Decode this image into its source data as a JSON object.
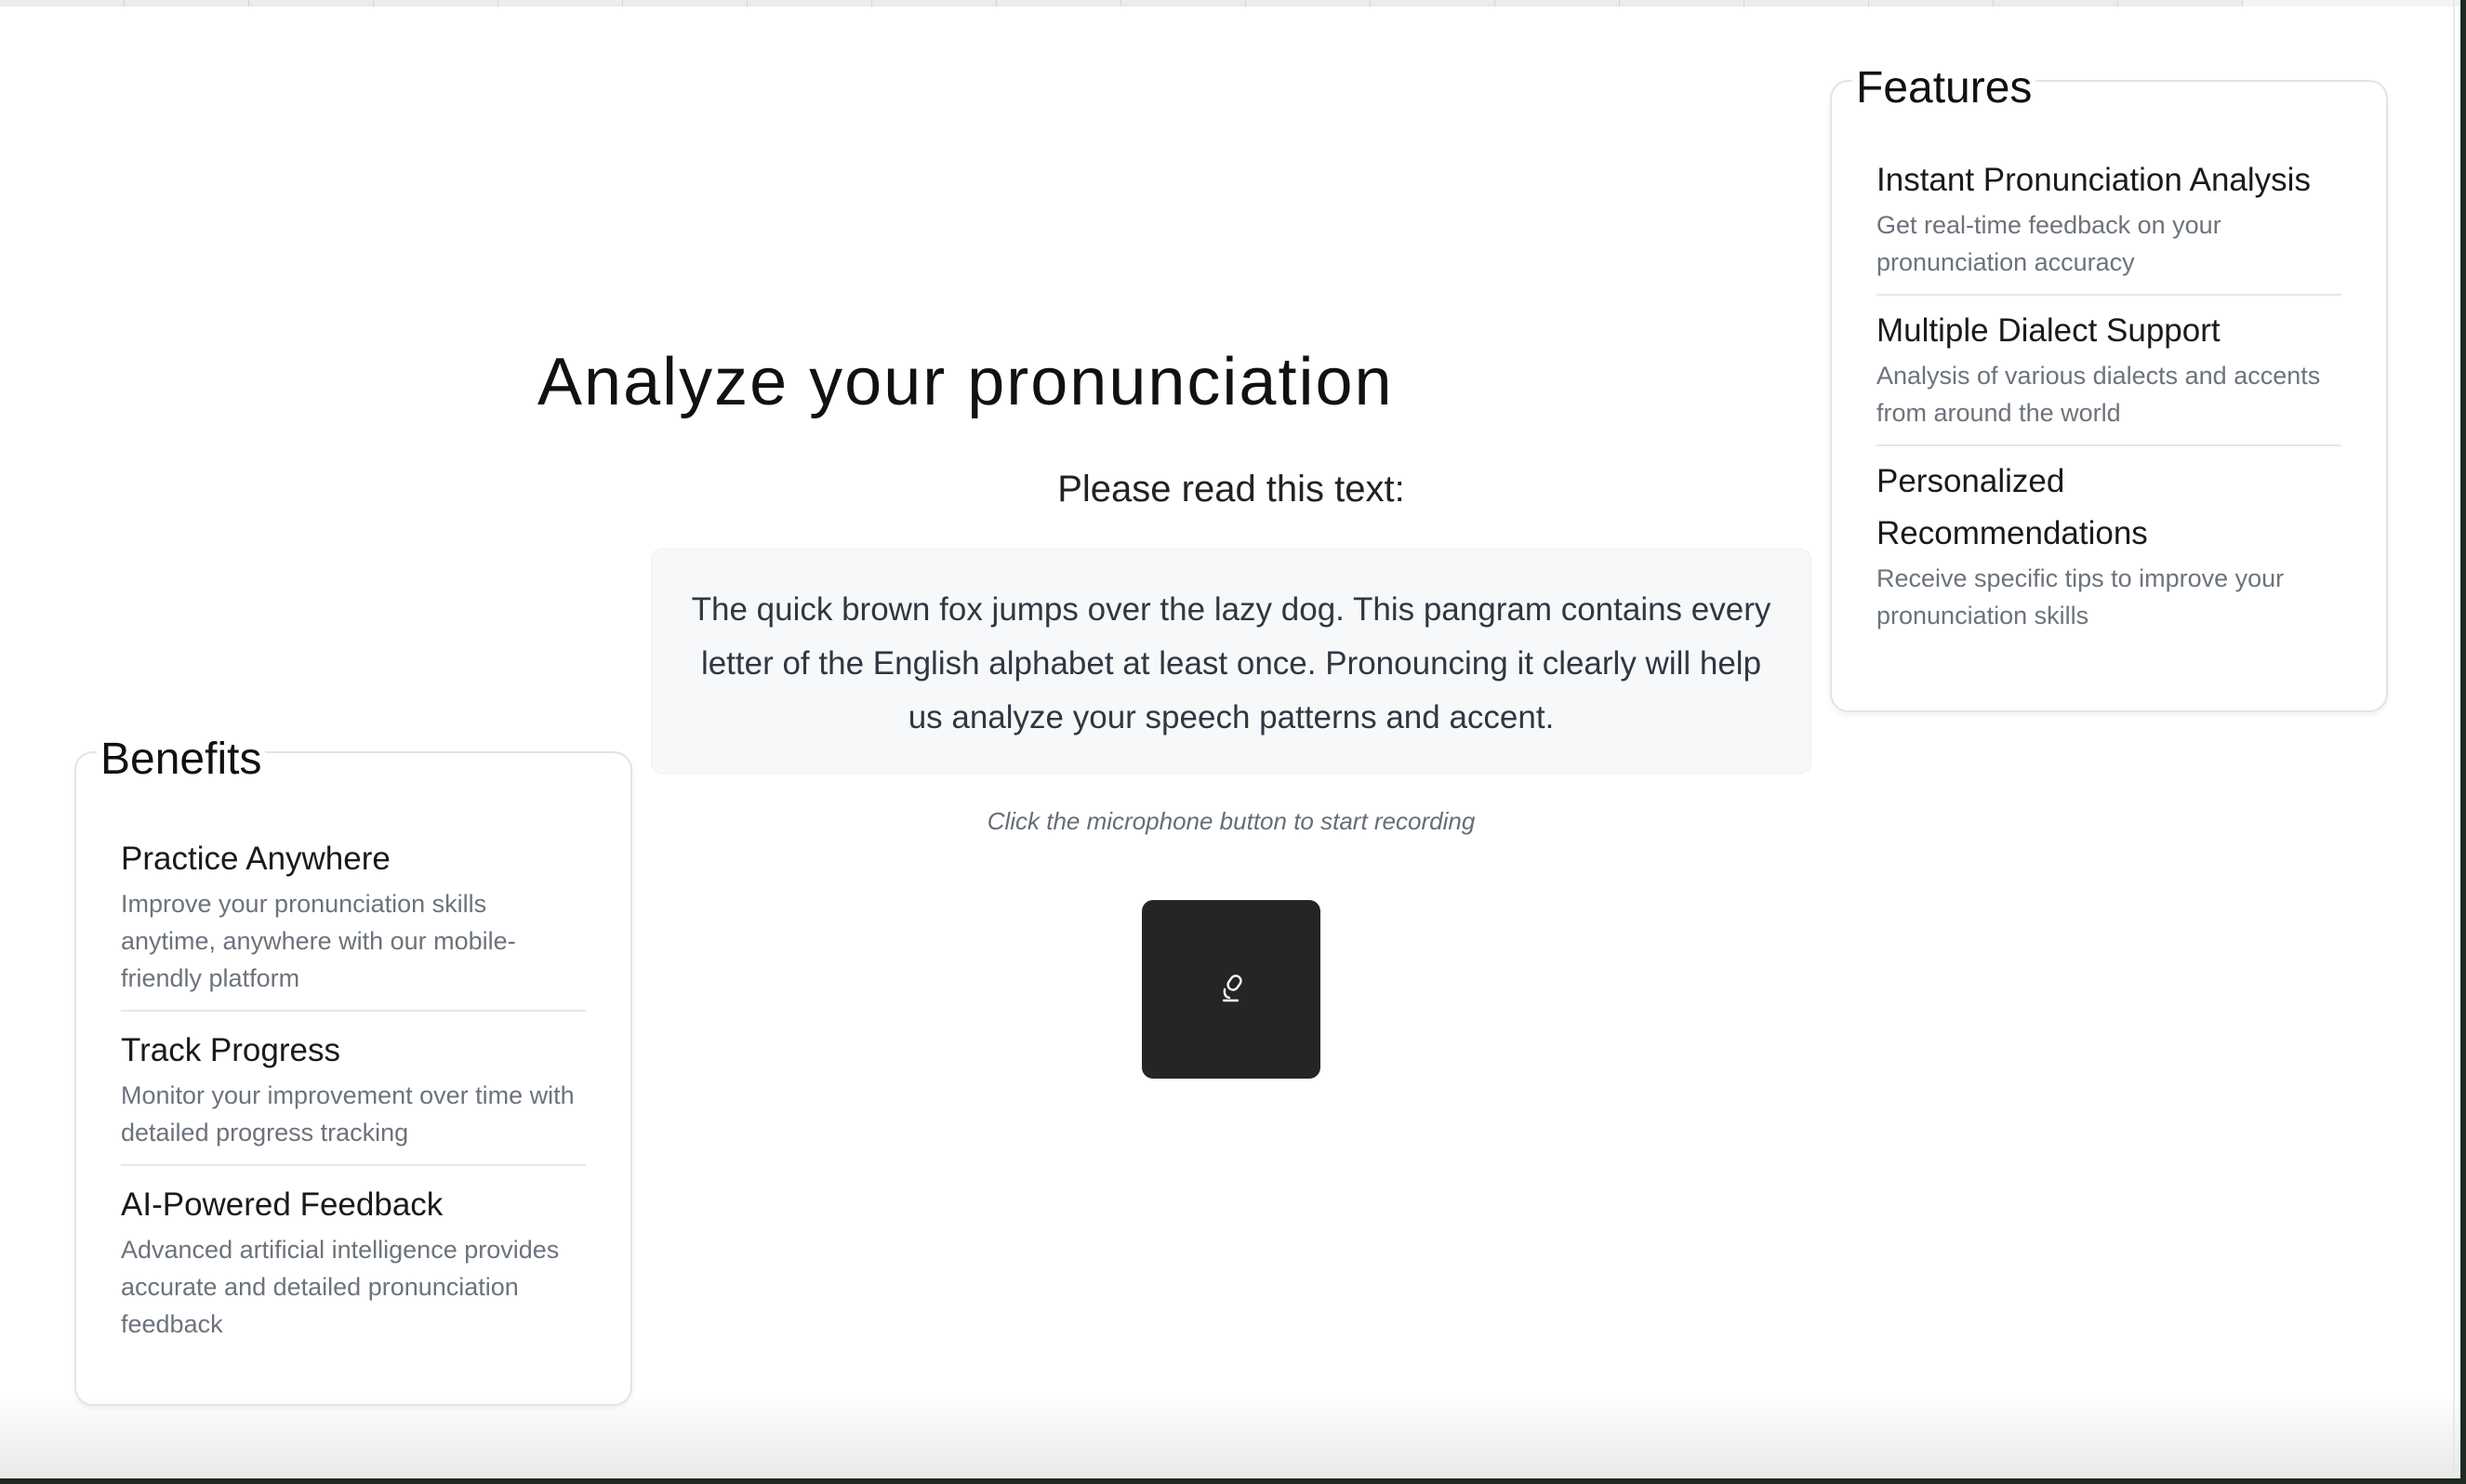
{
  "main": {
    "title": "Analyze your pronunciation",
    "prompt_label": "Please read this text:",
    "reading_text": "The quick brown fox jumps over the lazy dog. This pangram contains every letter of the English alphabet at least once. Pronouncing it clearly will help us analyze your speech patterns and accent.",
    "hint": "Click the microphone button to start recording",
    "record_button_icon": "microphone-icon"
  },
  "features": {
    "title": "Features",
    "items": [
      {
        "title": "Instant Pronunciation Analysis",
        "description": "Get real-time feedback on your pronunciation accuracy"
      },
      {
        "title": "Multiple Dialect Support",
        "description": "Analysis of various dialects and accents from around the world"
      },
      {
        "title": "Personalized Recommendations",
        "description": "Receive specific tips to improve your pronunciation skills"
      }
    ]
  },
  "benefits": {
    "title": "Benefits",
    "items": [
      {
        "title": "Practice Anywhere",
        "description": "Improve your pronunciation skills anytime, anywhere with our mobile-friendly platform"
      },
      {
        "title": "Track Progress",
        "description": "Monitor your improvement over time with detailed progress tracking"
      },
      {
        "title": "AI-Powered Feedback",
        "description": "Advanced artificial intelligence provides accurate and detailed pronunciation feedback"
      }
    ]
  },
  "colors": {
    "button_background": "#252525",
    "text_box_background": "#f7f8fa",
    "description_text": "#6c737c"
  }
}
